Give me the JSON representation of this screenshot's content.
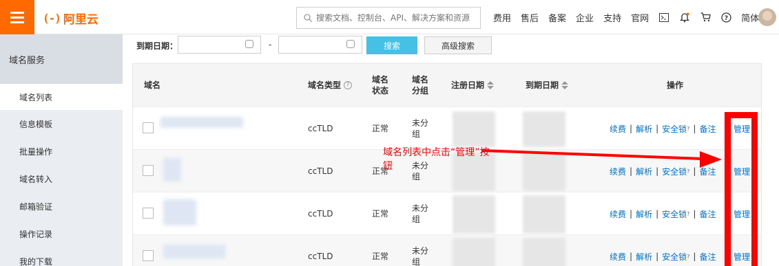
{
  "topbar": {
    "logo_text": "阿里云",
    "logo_mark": "(-)",
    "search_placeholder": "搜索文档、控制台、API、解决方案和资源",
    "nav": [
      "费用",
      "售后",
      "备案",
      "企业",
      "支持",
      "官网"
    ],
    "lang": "简体",
    "brand_color": "#ff6a00"
  },
  "sidebar": {
    "title": "域名服务",
    "items": [
      "域名列表",
      "信息模板",
      "批量操作",
      "域名转入",
      "邮箱验证",
      "操作记录",
      "我的下载"
    ],
    "active_index": 0
  },
  "filter": {
    "expiry_label": "到期日期：",
    "range_sep": "-",
    "search_button": "搜索",
    "advanced_button": "高级搜索"
  },
  "table": {
    "headers": {
      "domain": "域名",
      "type": "域名类型",
      "status": "域名状态",
      "group": "域名分组",
      "reg_date": "注册日期",
      "exp_date": "到期日期",
      "ops": "操作"
    },
    "rows": [
      {
        "type": "ccTLD",
        "status": "正常",
        "group": "未分组"
      },
      {
        "type": "ccTLD",
        "status": "正常",
        "group": "未分组"
      },
      {
        "type": "ccTLD",
        "status": "正常",
        "group": "未分组"
      },
      {
        "type": "ccTLD",
        "status": "正常",
        "group": "未分组"
      }
    ],
    "op_links": {
      "renew": "续费",
      "resolve": "解析",
      "lock": "安全锁",
      "remark": "备注",
      "manage": "管理"
    }
  },
  "annotation": {
    "text": "域名列表中点击“管理”按钮",
    "color": "#ff0000"
  }
}
